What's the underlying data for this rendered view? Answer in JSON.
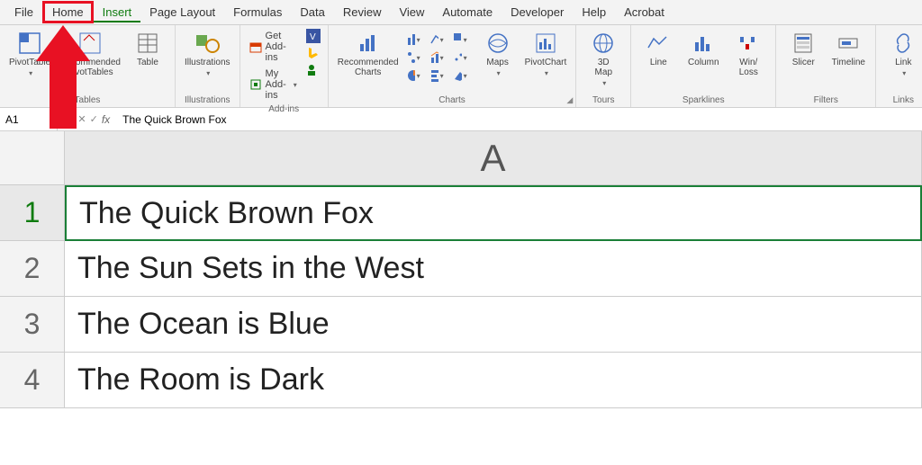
{
  "tabs": {
    "file": "File",
    "home": "Home",
    "insert": "Insert",
    "page_layout": "Page Layout",
    "formulas": "Formulas",
    "data": "Data",
    "review": "Review",
    "view": "View",
    "automate": "Automate",
    "developer": "Developer",
    "help": "Help",
    "acrobat": "Acrobat"
  },
  "ribbon": {
    "tables": {
      "pivot": "PivotTable",
      "recpivot": "Recommended\nPivotTables",
      "table": "Table",
      "group": "Tables"
    },
    "illus": {
      "label": "Illustrations",
      "group": "Illustrations"
    },
    "addins": {
      "get": "Get Add-ins",
      "my": "My Add-ins",
      "group": "Add-ins"
    },
    "charts": {
      "rec": "Recommended\nCharts",
      "maps": "Maps",
      "pivotchart": "PivotChart",
      "group": "Charts"
    },
    "tours": {
      "map": "3D\nMap",
      "group": "Tours"
    },
    "spark": {
      "line": "Line",
      "col": "Column",
      "wl": "Win/\nLoss",
      "group": "Sparklines"
    },
    "filters": {
      "slicer": "Slicer",
      "timeline": "Timeline",
      "group": "Filters"
    },
    "links": {
      "link": "Link",
      "group": "Links"
    }
  },
  "fbar": {
    "name": "A1",
    "formula": "The Quick Brown Fox"
  },
  "sheet": {
    "col": "A",
    "rows": [
      {
        "n": "1",
        "v": "The Quick Brown Fox"
      },
      {
        "n": "2",
        "v": "The Sun Sets in the West"
      },
      {
        "n": "3",
        "v": "The Ocean is Blue"
      },
      {
        "n": "4",
        "v": "The Room is Dark"
      }
    ]
  }
}
